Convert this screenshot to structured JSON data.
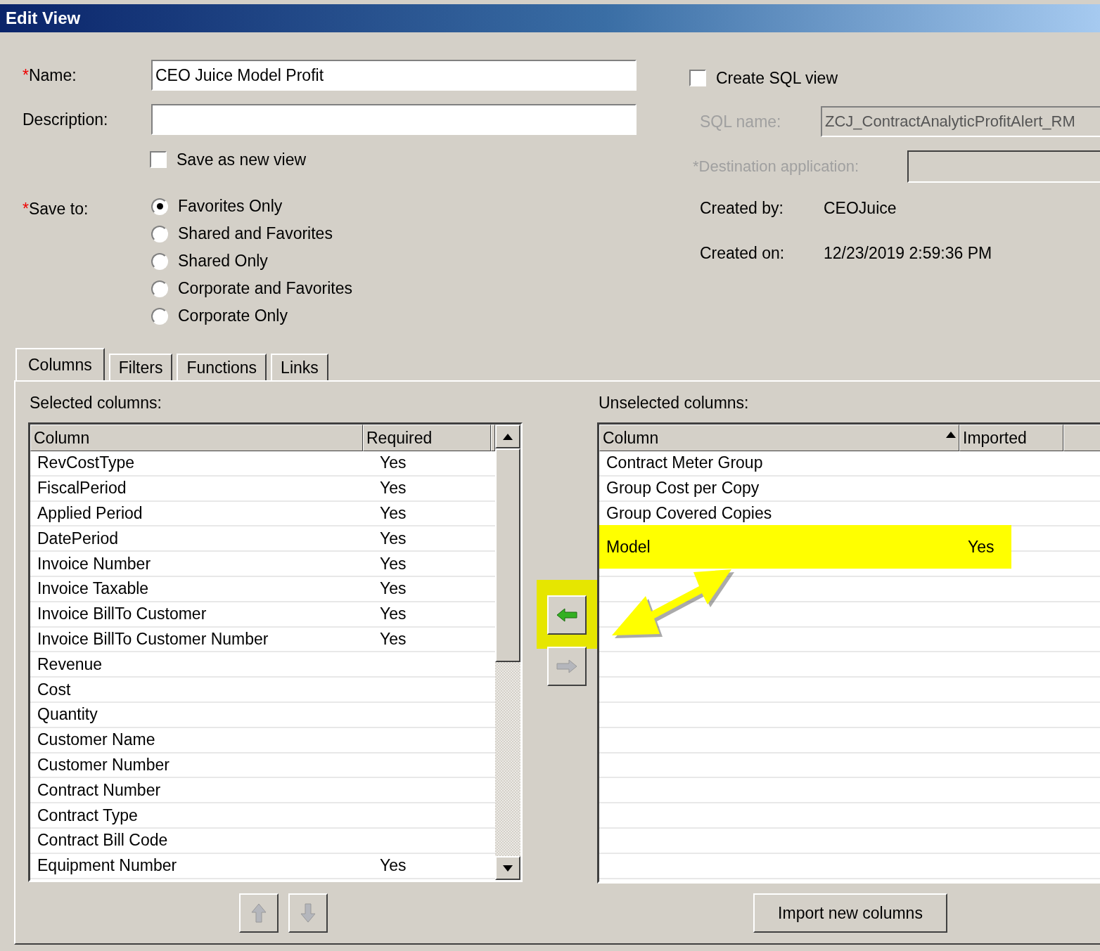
{
  "window": {
    "title": "Edit View"
  },
  "name": {
    "required_mark": "*",
    "label": "Name:",
    "value": "CEO Juice Model Profit"
  },
  "description": {
    "label": "Description:"
  },
  "save_as_new": {
    "label": "Save as new view",
    "checked": false
  },
  "save_to": {
    "required_mark": "*",
    "label": "Save to:",
    "options": [
      {
        "label": "Favorites Only",
        "selected": true
      },
      {
        "label": "Shared and Favorites",
        "selected": false
      },
      {
        "label": "Shared Only",
        "selected": false
      },
      {
        "label": "Corporate and Favorites",
        "selected": false
      },
      {
        "label": "Corporate Only",
        "selected": false
      }
    ]
  },
  "create_sql": {
    "label": "Create SQL view",
    "checked": false
  },
  "sql_name": {
    "label": "SQL name:",
    "value": "ZCJ_ContractAnalyticProfitAlert_RM",
    "disabled": true
  },
  "destination": {
    "required_mark": "*",
    "label": "Destination application:",
    "disabled": true
  },
  "created_by": {
    "label": "Created by:",
    "value": "CEOJuice"
  },
  "created_on": {
    "label": "Created on:",
    "value": "12/23/2019 2:59:36 PM"
  },
  "tabs": [
    {
      "label": "Columns",
      "selected": true
    },
    {
      "label": "Filters",
      "selected": false
    },
    {
      "label": "Functions",
      "selected": false
    },
    {
      "label": "Links",
      "selected": false
    }
  ],
  "selected_columns": {
    "label": "Selected columns:",
    "headers": [
      "Column",
      "Required"
    ],
    "rows": [
      {
        "column": "RevCostType",
        "required": "Yes"
      },
      {
        "column": "FiscalPeriod",
        "required": "Yes"
      },
      {
        "column": "Applied Period",
        "required": "Yes"
      },
      {
        "column": "DatePeriod",
        "required": "Yes"
      },
      {
        "column": "Invoice Number",
        "required": "Yes"
      },
      {
        "column": "Invoice Taxable",
        "required": "Yes"
      },
      {
        "column": "Invoice BillTo Customer",
        "required": "Yes"
      },
      {
        "column": "Invoice BillTo Customer Number",
        "required": "Yes"
      },
      {
        "column": "Revenue"
      },
      {
        "column": "Cost"
      },
      {
        "column": "Quantity"
      },
      {
        "column": "Customer Name"
      },
      {
        "column": "Customer Number"
      },
      {
        "column": "Contract Number"
      },
      {
        "column": "Contract Type"
      },
      {
        "column": "Contract Bill Code"
      },
      {
        "column": "Equipment Number",
        "required": "Yes"
      }
    ]
  },
  "unselected_columns": {
    "label": "Unselected columns:",
    "headers": [
      {
        "label": "Column",
        "sorted": true
      },
      {
        "label": "Imported",
        "sorted": false
      }
    ],
    "rows": [
      {
        "column": "Contract Meter Group",
        "highlighted": false
      },
      {
        "column": "Group Cost per Copy",
        "highlighted": false
      },
      {
        "column": "Group Covered Copies",
        "highlighted": false
      },
      {
        "column": "Model",
        "imported": "Yes",
        "highlighted": true
      }
    ]
  },
  "move_left": {
    "disabled": false,
    "highlighted": true
  },
  "move_right": {
    "disabled": true
  },
  "move_up": {
    "disabled": true
  },
  "move_down": {
    "disabled": true
  },
  "import_button": {
    "label": "Import new columns"
  }
}
